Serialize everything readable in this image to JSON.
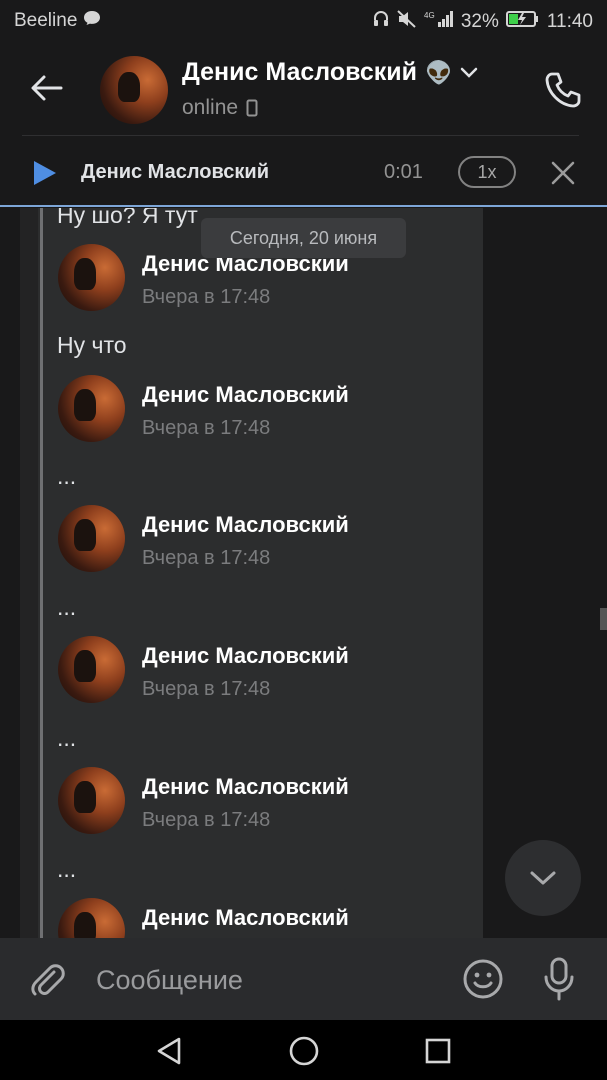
{
  "status_bar": {
    "carrier": "Beeline",
    "network": "4G",
    "battery": "32%",
    "time": "11:40",
    "icons": [
      "message-icon",
      "headset-icon",
      "mute-icon",
      "signal-icon",
      "battery-charging-icon"
    ]
  },
  "header": {
    "back_icon": "arrow-left-icon",
    "contact_name": "Денис Масловский",
    "name_emoji": "👽",
    "status": "online",
    "status_icon": "phone-device-icon",
    "dropdown_icon": "chevron-down-icon",
    "call_icon": "phone-icon"
  },
  "player": {
    "title": "Денис Масловский",
    "time": "0:01",
    "speed": "1x"
  },
  "chat": {
    "date_chip": "Сегодня, 20 июня",
    "top_text": "Ну шо? Я тут",
    "messages": [
      {
        "name": "Денис Масловский",
        "date": "Вчера в 17:48",
        "text": "Ну что"
      },
      {
        "name": "Денис Масловский",
        "date": "Вчера в 17:48",
        "text": "..."
      },
      {
        "name": "Денис Масловский",
        "date": "Вчера в 17:48",
        "text": "..."
      },
      {
        "name": "Денис Масловский",
        "date": "Вчера в 17:48",
        "text": "..."
      },
      {
        "name": "Денис Масловский",
        "date": "Вчера в 17:48",
        "text": "..."
      },
      {
        "name": "Денис Масловский",
        "date": "",
        "text": ""
      }
    ]
  },
  "composer": {
    "placeholder": "Сообщение"
  },
  "colors": {
    "background": "#19191a",
    "bubble": "#2c2d2e",
    "accent": "#4f8ee3",
    "player_border": "#7da6d8"
  }
}
